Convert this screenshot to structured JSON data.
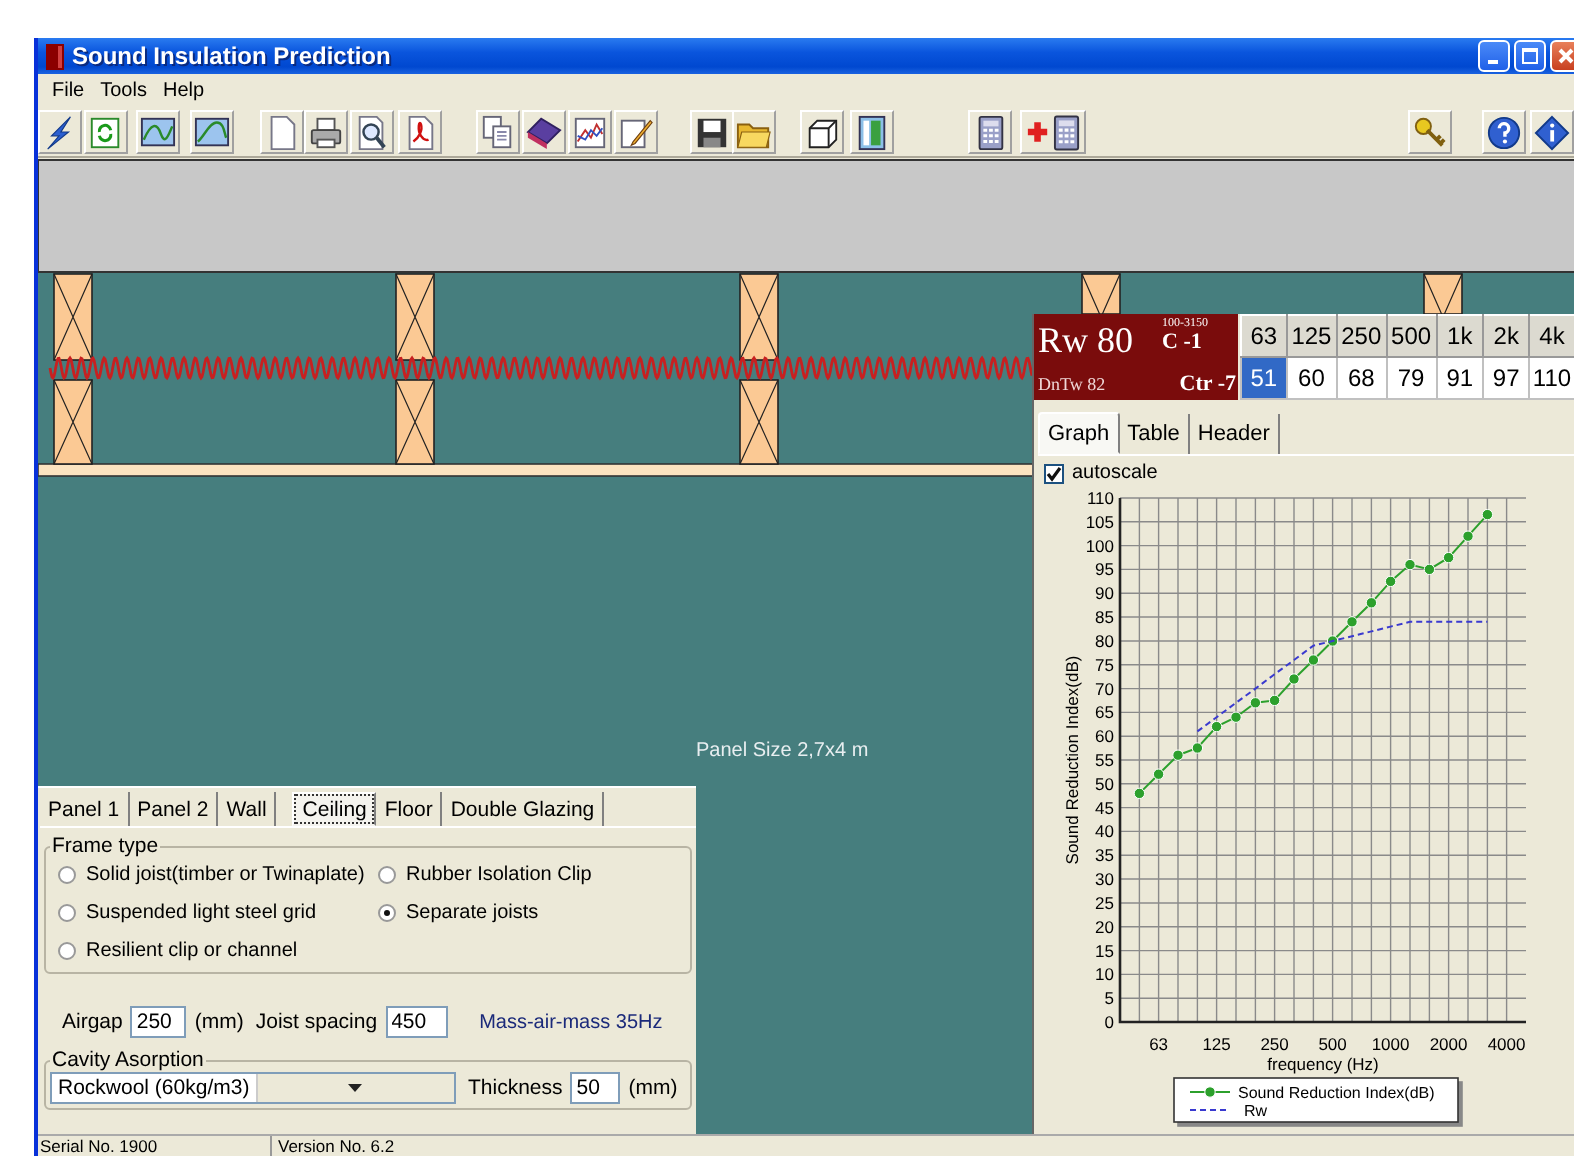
{
  "window": {
    "title": "Sound Insulation Prediction"
  },
  "menu": [
    {
      "label": "File"
    },
    {
      "label": "Tools"
    },
    {
      "label": "Help"
    }
  ],
  "canvas": {
    "panel_size": "Panel Size 2,7x4 m"
  },
  "results": {
    "rating": {
      "rw": "Rw 80",
      "dntw": "DnTw 82",
      "range": "100-3150",
      "c": "C -1",
      "ctr": "Ctr -7"
    },
    "octave_table": {
      "columns": [
        "63",
        "125",
        "250",
        "500",
        "1k",
        "2k",
        "4k"
      ],
      "values": [
        {
          "text": "51",
          "selected": true
        },
        {
          "text": "60",
          "selected": false
        },
        {
          "text": "68",
          "selected": false
        },
        {
          "text": "79",
          "selected": false
        },
        {
          "text": "91",
          "selected": false
        },
        {
          "text": "97",
          "selected": false
        },
        {
          "text": "110",
          "selected": false
        }
      ]
    },
    "tabs": [
      {
        "label": "Graph",
        "selected": true
      },
      {
        "label": "Table",
        "selected": false
      },
      {
        "label": "Header",
        "selected": false
      }
    ],
    "autoscale": {
      "label": "autoscale",
      "checked": true
    },
    "chart_data": {
      "type": "line",
      "xlabel": "frequency (Hz)",
      "ylabel": "Sound Reduction Index(dB)",
      "categories": [
        null,
        "63",
        null,
        null,
        "125",
        null,
        null,
        "250",
        null,
        null,
        "500",
        null,
        null,
        "1000",
        null,
        null,
        "2000",
        null,
        null,
        "4000"
      ],
      "grid": true,
      "legend": "below",
      "series": [
        {
          "name": "Sound Reduction Index(dB)",
          "color": "#2ca02c",
          "marker": "o",
          "line_style": "solid",
          "values": [
            48,
            52,
            56,
            57.5,
            62,
            64,
            67,
            67.5,
            72,
            76,
            80,
            84,
            88,
            92.5,
            96,
            95,
            97.5,
            102,
            106.5,
            null
          ]
        },
        {
          "name": "Rw",
          "color": "#3a3acf",
          "line_style": "dashed",
          "values": [
            null,
            null,
            null,
            61,
            64,
            67,
            70,
            73,
            76,
            79,
            80,
            81,
            82,
            83,
            84,
            84,
            84,
            84,
            84,
            null
          ]
        }
      ],
      "ylim": [
        0,
        110
      ],
      "yticks": [
        0,
        5,
        10,
        15,
        20,
        25,
        30,
        35,
        40,
        45,
        50,
        55,
        60,
        65,
        70,
        75,
        80,
        85,
        90,
        95,
        100,
        105,
        110
      ]
    }
  },
  "construction": {
    "tabs": [
      {
        "label": "Panel 1",
        "selected": false
      },
      {
        "label": "Panel 2",
        "selected": false
      },
      {
        "label": "Wall",
        "selected": false
      },
      {
        "label": "Ceiling",
        "selected": true
      },
      {
        "label": "Floor",
        "selected": false
      },
      {
        "label": "Double Glazing",
        "selected": false
      }
    ],
    "frame_type": {
      "title": "Frame type",
      "options": [
        {
          "label": "Solid joist(timber or Twinaplate)",
          "selected": false
        },
        {
          "label": "Rubber Isolation Clip",
          "selected": false
        },
        {
          "label": "Suspended light steel grid",
          "selected": false
        },
        {
          "label": "Separate joists",
          "selected": true
        },
        {
          "label": "Resilient clip or channel",
          "selected": false
        }
      ]
    },
    "airgap": {
      "label": "Airgap",
      "value": "250",
      "unit": "(mm)"
    },
    "joist_spacing": {
      "label": "Joist spacing",
      "value": "450"
    },
    "mass_air_mass": "Mass-air-mass 35Hz",
    "cavity": {
      "title": "Cavity Asorption",
      "material": "Rockwool (60kg/m3)",
      "thickness_label": "Thickness",
      "thickness": "50",
      "unit": "(mm)"
    }
  },
  "status_bar": [
    {
      "text": "Serial No. 1900"
    },
    {
      "text": "Version No. 6.2"
    }
  ]
}
